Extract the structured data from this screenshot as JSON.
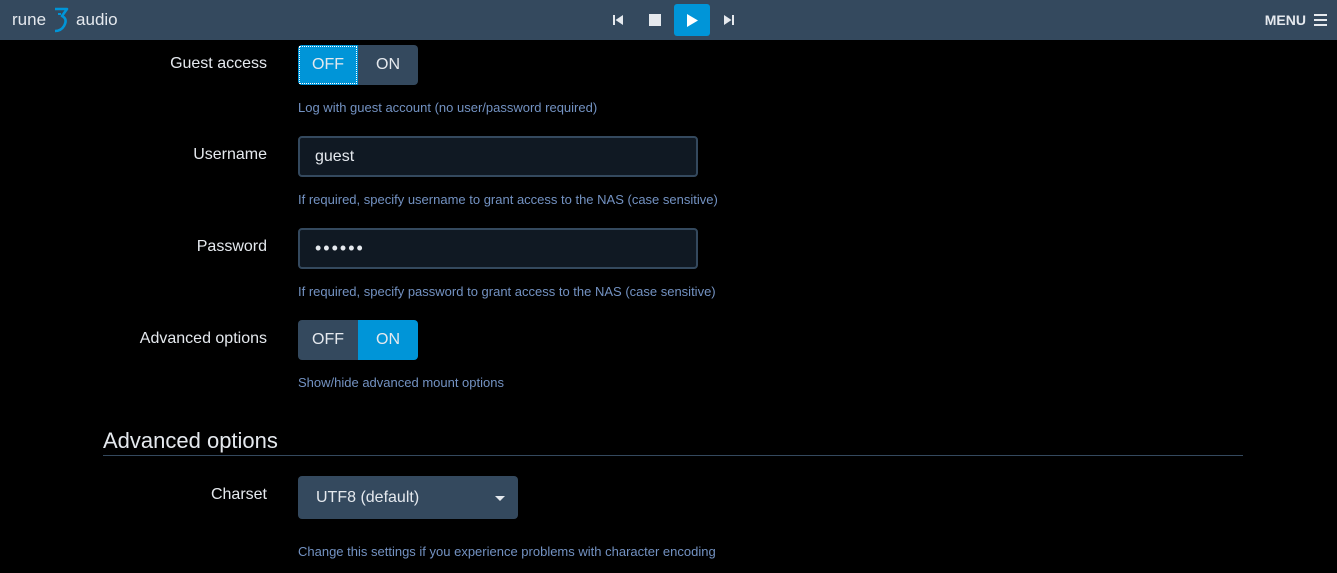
{
  "brand": {
    "left": "rune",
    "right": "audio"
  },
  "transport": {
    "prev_icon": "skip-previous-icon",
    "stop_icon": "stop-icon",
    "play_icon": "play-icon",
    "next_icon": "skip-next-icon"
  },
  "menu": {
    "label": "MENU",
    "icon": "hamburger-icon"
  },
  "form": {
    "guest_access": {
      "label": "Guest access",
      "off_label": "OFF",
      "on_label": "ON",
      "selected": "OFF",
      "help": "Log with guest account (no user/password required)"
    },
    "username": {
      "label": "Username",
      "value": "guest",
      "help": "If required, specify username to grant access to the NAS (case sensitive)"
    },
    "password": {
      "label": "Password",
      "value": "••••••",
      "help": "If required, specify password to grant access to the NAS (case sensitive)"
    },
    "advanced_toggle": {
      "label": "Advanced options",
      "off_label": "OFF",
      "on_label": "ON",
      "selected": "ON",
      "help": "Show/hide advanced mount options"
    }
  },
  "advanced": {
    "title": "Advanced options",
    "charset": {
      "label": "Charset",
      "value": "UTF8 (default)",
      "help": "Change this settings if you experience problems with character encoding"
    }
  },
  "colors": {
    "topbar": "#34495e",
    "accent": "#0095d8",
    "help_text": "#7392c2",
    "input_bg": "#101923"
  }
}
